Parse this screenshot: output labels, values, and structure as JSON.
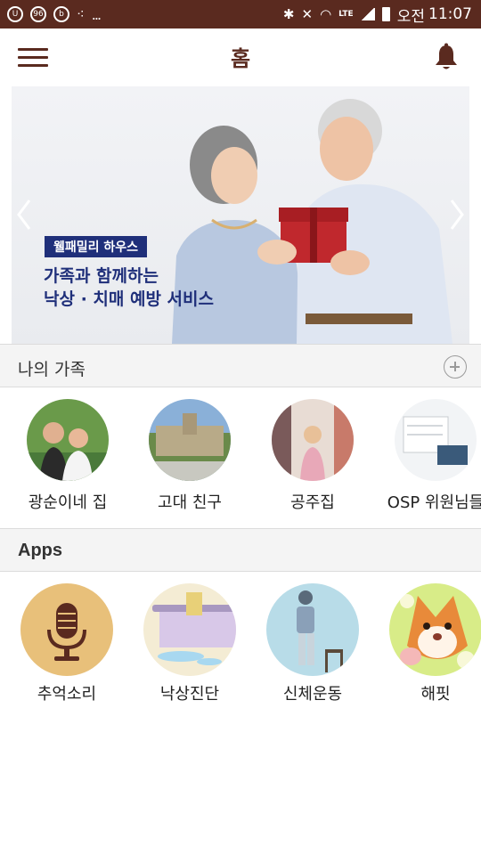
{
  "status_bar": {
    "notif_badge": "96",
    "overflow": "...",
    "lte": "LTE",
    "ampm": "오전",
    "time": "11:07"
  },
  "header": {
    "title": "홈",
    "accent_color": "#5a2a1f",
    "menu_icon": "hamburger-menu-icon",
    "bell_icon": "bell-icon"
  },
  "banner": {
    "tag": "웰패밀리 하우스",
    "line1": "가족과 함께하는",
    "line2": "낙상 · 치매 예방 서비스"
  },
  "family_section": {
    "title": "나의 가족",
    "items": [
      {
        "label": "광순이네 집"
      },
      {
        "label": "고대 친구"
      },
      {
        "label": "공주집"
      },
      {
        "label": "OSP 위원님들"
      }
    ]
  },
  "apps_section": {
    "title": "Apps",
    "items": [
      {
        "label": "추억소리",
        "icon": "microphone-icon"
      },
      {
        "label": "낙상진단",
        "icon": "bathtub-icon"
      },
      {
        "label": "신체운동",
        "icon": "exercise-person-icon"
      },
      {
        "label": "해핏",
        "icon": "fox-character-icon"
      }
    ]
  }
}
